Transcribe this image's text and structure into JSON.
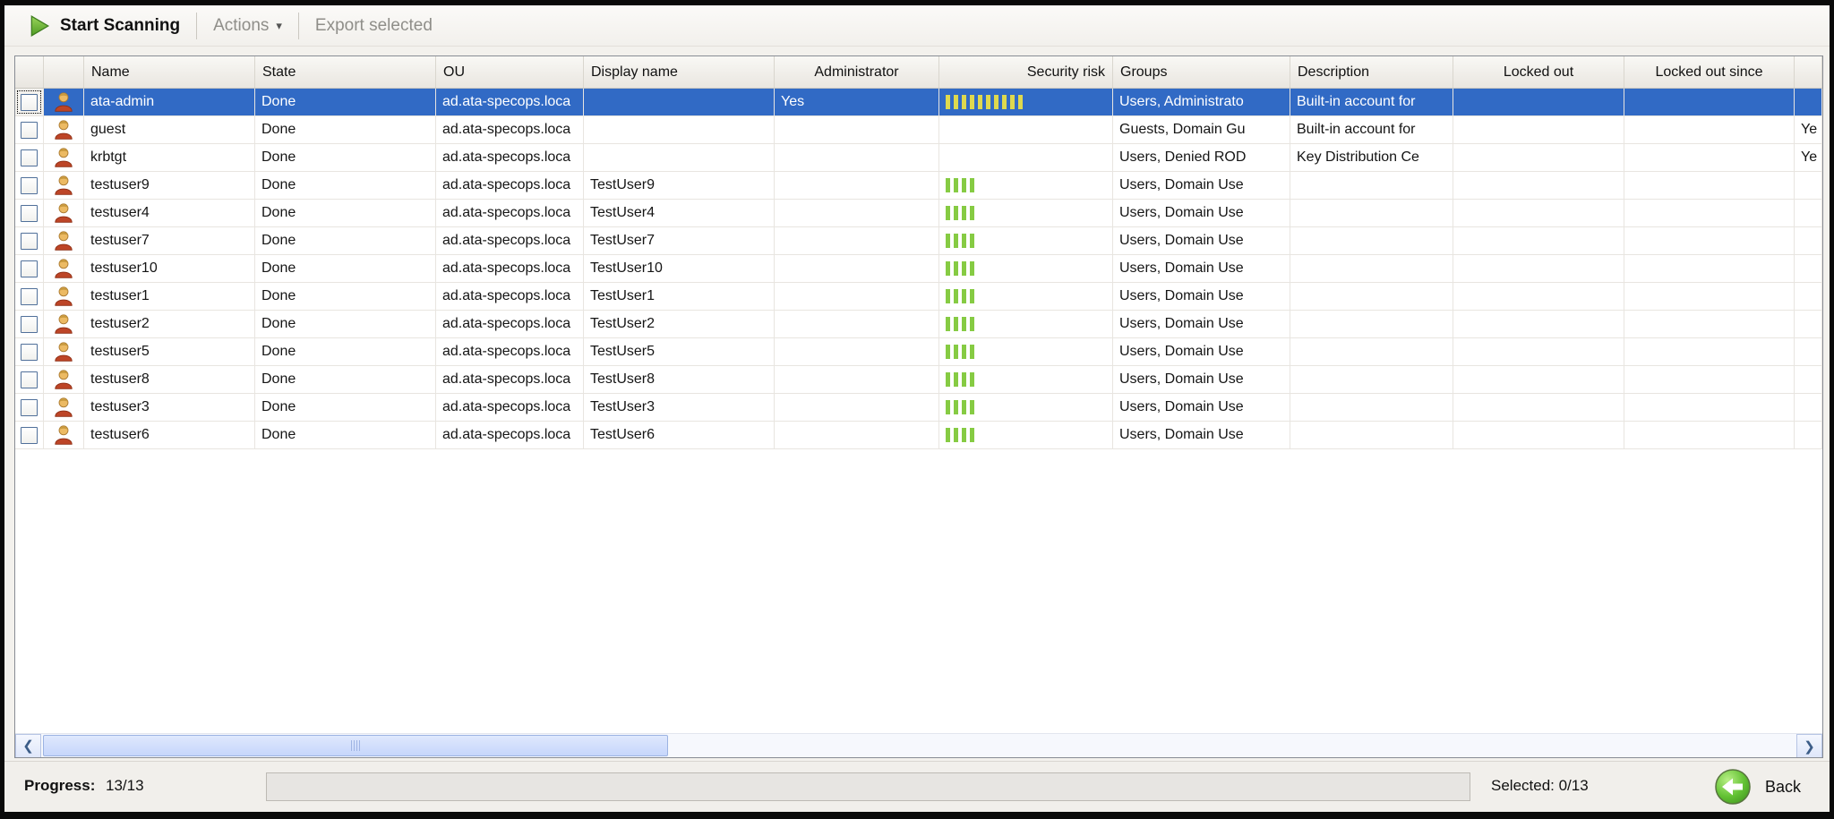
{
  "toolbar": {
    "start_scanning": "Start Scanning",
    "actions": "Actions",
    "export_selected": "Export selected"
  },
  "table": {
    "columns": [
      "",
      "",
      "Name",
      "State",
      "OU",
      "Display name",
      "Administrator",
      "Security risk",
      "Groups",
      "Description",
      "Locked out",
      "Locked out since",
      ""
    ],
    "rows": [
      {
        "name": "ata-admin",
        "state": "Done",
        "ou": "ad.ata-specops.loca",
        "display_name": "",
        "administrator": "Yes",
        "security_risk": 10,
        "risk_level": "high",
        "groups": "Users, Administrato",
        "description": "Built-in account for",
        "locked_out": "",
        "locked_out_since": "",
        "extra": "",
        "selected": true
      },
      {
        "name": "guest",
        "state": "Done",
        "ou": "ad.ata-specops.loca",
        "display_name": "",
        "administrator": "",
        "security_risk": 0,
        "risk_level": "",
        "groups": "Guests, Domain Gu",
        "description": "Built-in account for",
        "locked_out": "",
        "locked_out_since": "",
        "extra": "Ye",
        "selected": false
      },
      {
        "name": "krbtgt",
        "state": "Done",
        "ou": "ad.ata-specops.loca",
        "display_name": "",
        "administrator": "",
        "security_risk": 0,
        "risk_level": "",
        "groups": "Users, Denied ROD",
        "description": "Key Distribution Ce",
        "locked_out": "",
        "locked_out_since": "",
        "extra": "Ye",
        "selected": false
      },
      {
        "name": "testuser9",
        "state": "Done",
        "ou": "ad.ata-specops.loca",
        "display_name": "TestUser9",
        "administrator": "",
        "security_risk": 4,
        "risk_level": "low",
        "groups": "Users, Domain Use",
        "description": "",
        "locked_out": "",
        "locked_out_since": "",
        "extra": "",
        "selected": false
      },
      {
        "name": "testuser4",
        "state": "Done",
        "ou": "ad.ata-specops.loca",
        "display_name": "TestUser4",
        "administrator": "",
        "security_risk": 4,
        "risk_level": "low",
        "groups": "Users, Domain Use",
        "description": "",
        "locked_out": "",
        "locked_out_since": "",
        "extra": "",
        "selected": false
      },
      {
        "name": "testuser7",
        "state": "Done",
        "ou": "ad.ata-specops.loca",
        "display_name": "TestUser7",
        "administrator": "",
        "security_risk": 4,
        "risk_level": "low",
        "groups": "Users, Domain Use",
        "description": "",
        "locked_out": "",
        "locked_out_since": "",
        "extra": "",
        "selected": false
      },
      {
        "name": "testuser10",
        "state": "Done",
        "ou": "ad.ata-specops.loca",
        "display_name": "TestUser10",
        "administrator": "",
        "security_risk": 4,
        "risk_level": "low",
        "groups": "Users, Domain Use",
        "description": "",
        "locked_out": "",
        "locked_out_since": "",
        "extra": "",
        "selected": false
      },
      {
        "name": "testuser1",
        "state": "Done",
        "ou": "ad.ata-specops.loca",
        "display_name": "TestUser1",
        "administrator": "",
        "security_risk": 4,
        "risk_level": "low",
        "groups": "Users, Domain Use",
        "description": "",
        "locked_out": "",
        "locked_out_since": "",
        "extra": "",
        "selected": false
      },
      {
        "name": "testuser2",
        "state": "Done",
        "ou": "ad.ata-specops.loca",
        "display_name": "TestUser2",
        "administrator": "",
        "security_risk": 4,
        "risk_level": "low",
        "groups": "Users, Domain Use",
        "description": "",
        "locked_out": "",
        "locked_out_since": "",
        "extra": "",
        "selected": false
      },
      {
        "name": "testuser5",
        "state": "Done",
        "ou": "ad.ata-specops.loca",
        "display_name": "TestUser5",
        "administrator": "",
        "security_risk": 4,
        "risk_level": "low",
        "groups": "Users, Domain Use",
        "description": "",
        "locked_out": "",
        "locked_out_since": "",
        "extra": "",
        "selected": false
      },
      {
        "name": "testuser8",
        "state": "Done",
        "ou": "ad.ata-specops.loca",
        "display_name": "TestUser8",
        "administrator": "",
        "security_risk": 4,
        "risk_level": "low",
        "groups": "Users, Domain Use",
        "description": "",
        "locked_out": "",
        "locked_out_since": "",
        "extra": "",
        "selected": false
      },
      {
        "name": "testuser3",
        "state": "Done",
        "ou": "ad.ata-specops.loca",
        "display_name": "TestUser3",
        "administrator": "",
        "security_risk": 4,
        "risk_level": "low",
        "groups": "Users, Domain Use",
        "description": "",
        "locked_out": "",
        "locked_out_since": "",
        "extra": "",
        "selected": false
      },
      {
        "name": "testuser6",
        "state": "Done",
        "ou": "ad.ata-specops.loca",
        "display_name": "TestUser6",
        "administrator": "",
        "security_risk": 4,
        "risk_level": "low",
        "groups": "Users, Domain Use",
        "description": "",
        "locked_out": "",
        "locked_out_since": "",
        "extra": "",
        "selected": false
      }
    ]
  },
  "statusbar": {
    "progress_label": "Progress:",
    "progress_value": "13/13",
    "selected_text": "Selected: 0/13",
    "back_label": "Back"
  },
  "colors": {
    "selection_blue": "#316ac5",
    "risk_high_yellow": "#ded94f",
    "risk_low_green": "#86cb43",
    "play_icon_green": "#63b32a",
    "back_icon_green": "#4fae27"
  }
}
